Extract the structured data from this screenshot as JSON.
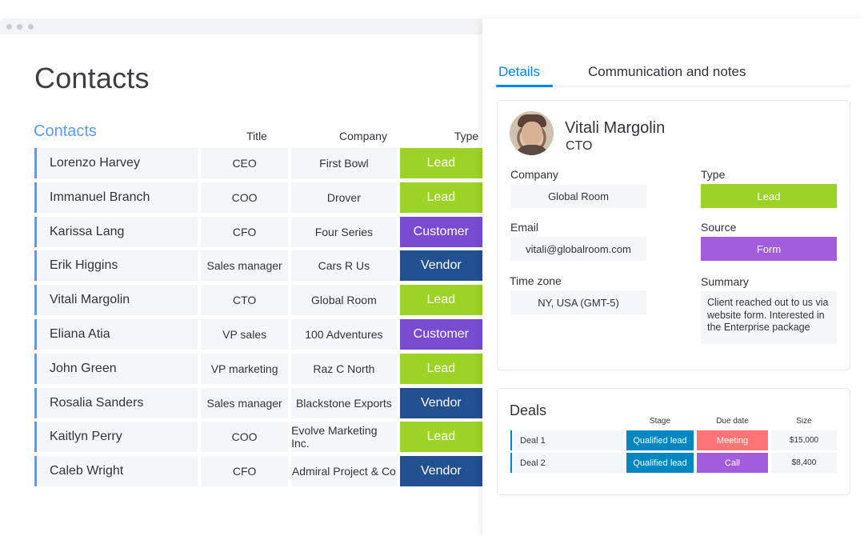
{
  "window": {
    "controls": [
      "close",
      "minimize",
      "maximize"
    ]
  },
  "board": {
    "title": "Contacts",
    "group_title": "Contacts",
    "columns": {
      "name": "",
      "title": "Title",
      "company": "Company",
      "type": "Type"
    },
    "rows": [
      {
        "name": "Lorenzo Harvey",
        "title": "CEO",
        "company": "First Bowl",
        "type": "Lead",
        "type_color": "#9cd326"
      },
      {
        "name": "Immanuel Branch",
        "title": "COO",
        "company": "Drover",
        "type": "Lead",
        "type_color": "#9cd326"
      },
      {
        "name": "Karissa Lang",
        "title": "CFO",
        "company": "Four Series",
        "type": "Customer",
        "type_color": "#784bd1"
      },
      {
        "name": "Erik Higgins",
        "title": "Sales manager",
        "company": "Cars R Us",
        "type": "Vendor",
        "type_color": "#225091"
      },
      {
        "name": "Vitali Margolin",
        "title": "CTO",
        "company": "Global Room",
        "type": "Lead",
        "type_color": "#9cd326"
      },
      {
        "name": "Eliana Atia",
        "title": "VP sales",
        "company": "100 Adventures",
        "type": "Customer",
        "type_color": "#784bd1"
      },
      {
        "name": "John Green",
        "title": "VP marketing",
        "company": "Raz C North",
        "type": "Lead",
        "type_color": "#9cd326"
      },
      {
        "name": "Rosalia Sanders",
        "title": "Sales manager",
        "company": "Blackstone Exports",
        "type": "Vendor",
        "type_color": "#225091"
      },
      {
        "name": "Kaitlyn Perry",
        "title": "COO",
        "company": "Evolve Marketing Inc.",
        "type": "Lead",
        "type_color": "#9cd326"
      },
      {
        "name": "Caleb Wright",
        "title": "CFO",
        "company": "Admiral Project & Co",
        "type": "Vendor",
        "type_color": "#225091"
      }
    ]
  },
  "panel": {
    "tabs": [
      {
        "label": "Details",
        "active": true
      },
      {
        "label": "Communication and notes",
        "active": false
      }
    ],
    "contact": {
      "name": "Vitali Margolin",
      "title": "CTO",
      "avatar_icon": "user-photo",
      "fields": {
        "company": {
          "label": "Company",
          "value": "Global Room"
        },
        "email": {
          "label": "Email",
          "value": "vitali@globalroom.com"
        },
        "time_zone": {
          "label": "Time zone",
          "value": "NY, USA (GMT-5)"
        },
        "type": {
          "label": "Type",
          "value": "Lead",
          "color": "#9cd326"
        },
        "source": {
          "label": "Source",
          "value": "Form",
          "color": "#a25ddc"
        },
        "summary": {
          "label": "Summary",
          "value": "Client reached out to us via website form. Interested in the Enterprise package"
        }
      }
    },
    "deals": {
      "title": "Deals",
      "columns": {
        "stage": "Stage",
        "due_date": "Due date",
        "size": "Size"
      },
      "rows": [
        {
          "name": "Deal 1",
          "stage": "Qualified lead",
          "stage_color": "#0086c0",
          "due": "Meeting",
          "due_color": "#ff7575",
          "size": "$15,000"
        },
        {
          "name": "Deal 2",
          "stage": "Qualified lead",
          "stage_color": "#0086c0",
          "due": "Call",
          "due_color": "#a25ddc",
          "size": "$8,400"
        }
      ]
    }
  },
  "colors": {
    "accent": "#579bfc",
    "tab_active": "#0085ff"
  }
}
